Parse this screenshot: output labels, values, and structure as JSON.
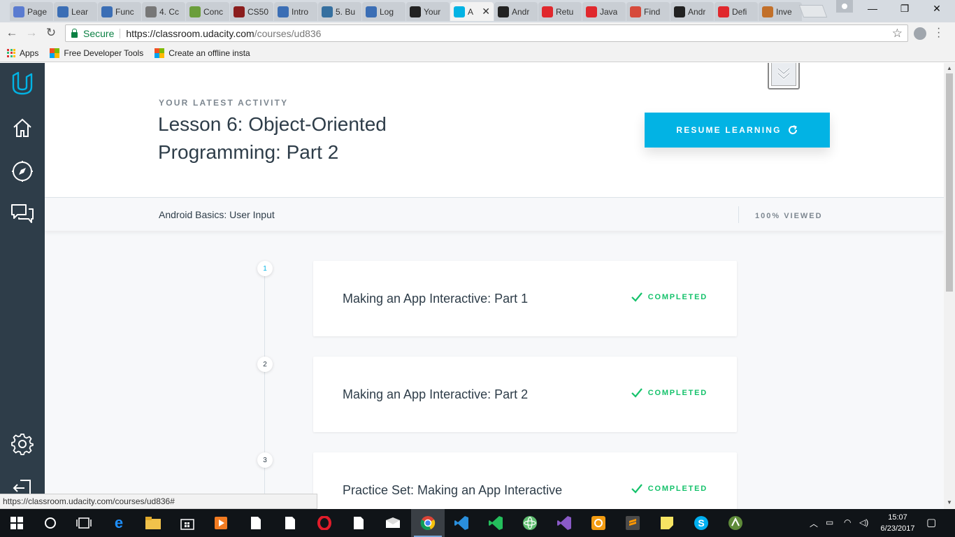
{
  "browser": {
    "tabs": [
      {
        "label": "Page",
        "icon": "gear-page-icon",
        "color": "#5a7bd0"
      },
      {
        "label": "Lear",
        "icon": "document-icon",
        "color": "#3b6eb5"
      },
      {
        "label": "Func",
        "icon": "document-icon",
        "color": "#3b6eb5"
      },
      {
        "label": "4. Cc",
        "icon": "blank-page-icon",
        "color": "#777777"
      },
      {
        "label": "Conc",
        "icon": "globe-icon",
        "color": "#6b9e3b"
      },
      {
        "label": "CS50",
        "icon": "shield-icon",
        "color": "#8b1d1d"
      },
      {
        "label": "Intro",
        "icon": "document-icon",
        "color": "#3b6eb5"
      },
      {
        "label": "5. Bu",
        "icon": "python-icon",
        "color": "#3670a0"
      },
      {
        "label": "Log",
        "icon": "document-icon",
        "color": "#3b6eb5"
      },
      {
        "label": "Your",
        "icon": "github-icon",
        "color": "#222222"
      },
      {
        "label": "A",
        "icon": "udacity-icon",
        "color": "#02b3e4",
        "active": true
      },
      {
        "label": "Andr",
        "icon": "github-icon",
        "color": "#222222"
      },
      {
        "label": "Retu",
        "icon": "oracle-icon",
        "color": "#e0282d"
      },
      {
        "label": "Java",
        "icon": "oracle-icon",
        "color": "#e0282d"
      },
      {
        "label": "Find",
        "icon": "google-plus-icon",
        "color": "#d64a3b"
      },
      {
        "label": "Andr",
        "icon": "github-icon",
        "color": "#222222"
      },
      {
        "label": "Defi",
        "icon": "oracle-icon",
        "color": "#e0282d"
      },
      {
        "label": "Inve",
        "icon": "orange-circle-icon",
        "color": "#c2702a"
      }
    ],
    "secure_label": "Secure",
    "url_host": "https://classroom.udacity.com",
    "url_path": "/courses/ud836",
    "bookmarks": {
      "apps": "Apps",
      "item1": "Free Developer Tools",
      "item2": "Create an offline insta"
    },
    "status_url": "https://classroom.udacity.com/courses/ud836#"
  },
  "page": {
    "eyebrow": "YOUR LATEST ACTIVITY",
    "lesson_title": "Lesson 6: Object-Oriented Programming: Part 2",
    "resume_label": "RESUME LEARNING",
    "course_name": "Android Basics: User Input",
    "viewed_label": "100% VIEWED",
    "concepts": [
      {
        "num": "1",
        "title": "Making an App Interactive: Part 1",
        "status": "COMPLETED"
      },
      {
        "num": "2",
        "title": "Making an App Interactive: Part 2",
        "status": "COMPLETED"
      },
      {
        "num": "3",
        "title": "Practice Set: Making an App Interactive",
        "status": "COMPLETED"
      }
    ],
    "colors": {
      "sidebar": "#2e3d49",
      "accent": "#02b3e4",
      "completed": "#15c26b"
    }
  },
  "taskbar": {
    "time": "15:07",
    "date": "6/23/2017"
  }
}
